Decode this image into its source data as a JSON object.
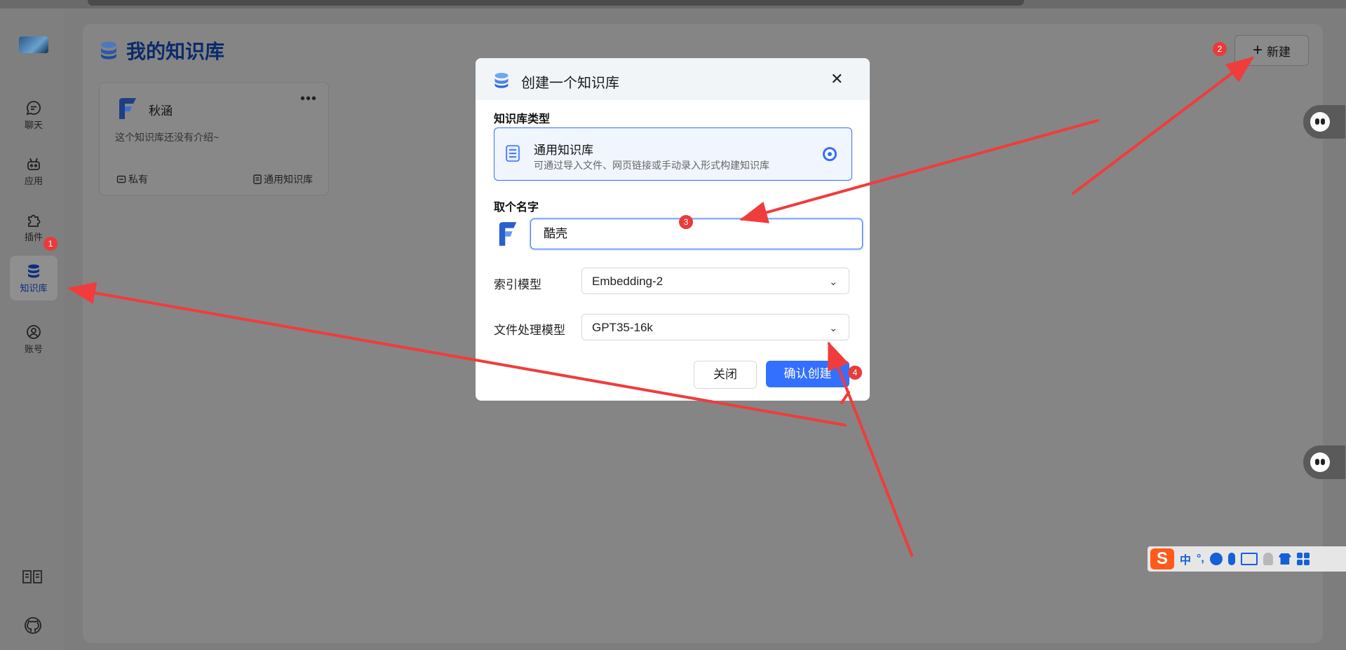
{
  "sidebar": {
    "items": [
      {
        "label": "聊天",
        "icon": "chat-icon"
      },
      {
        "label": "应用",
        "icon": "robot-icon"
      },
      {
        "label": "插件",
        "icon": "puzzle-icon"
      },
      {
        "label": "知识库",
        "icon": "database-icon",
        "active": true
      },
      {
        "label": "账号",
        "icon": "account-icon"
      }
    ],
    "bottom_icons": [
      "book-icon",
      "github-icon"
    ]
  },
  "header": {
    "title": "我的知识库",
    "new_button": "新建"
  },
  "kb_cards": [
    {
      "name": "秋涵",
      "intro": "这个知识库还没有介绍~",
      "permission": "私有",
      "type": "通用知识库"
    }
  ],
  "dialog": {
    "title": "创建一个知识库",
    "type_section": "知识库类型",
    "type_option": {
      "name": "通用知识库",
      "desc": "可通过导入文件、网页链接或手动录入形式构建知识库",
      "selected": true
    },
    "name_section": "取个名字",
    "name_value": "酷壳",
    "index_model_label": "索引模型",
    "index_model_value": "Embedding-2",
    "file_model_label": "文件处理模型",
    "file_model_value": "GPT35-16k",
    "close_button": "关闭",
    "confirm_button": "确认创建"
  },
  "annotations": {
    "b1": "1",
    "b2": "2",
    "b3": "3",
    "b4": "4"
  },
  "ime": {
    "chars": [
      "中",
      "°,"
    ]
  },
  "colors": {
    "accent": "#3370ff",
    "badge": "#e83b3b",
    "arrow": "#f03c3c"
  }
}
